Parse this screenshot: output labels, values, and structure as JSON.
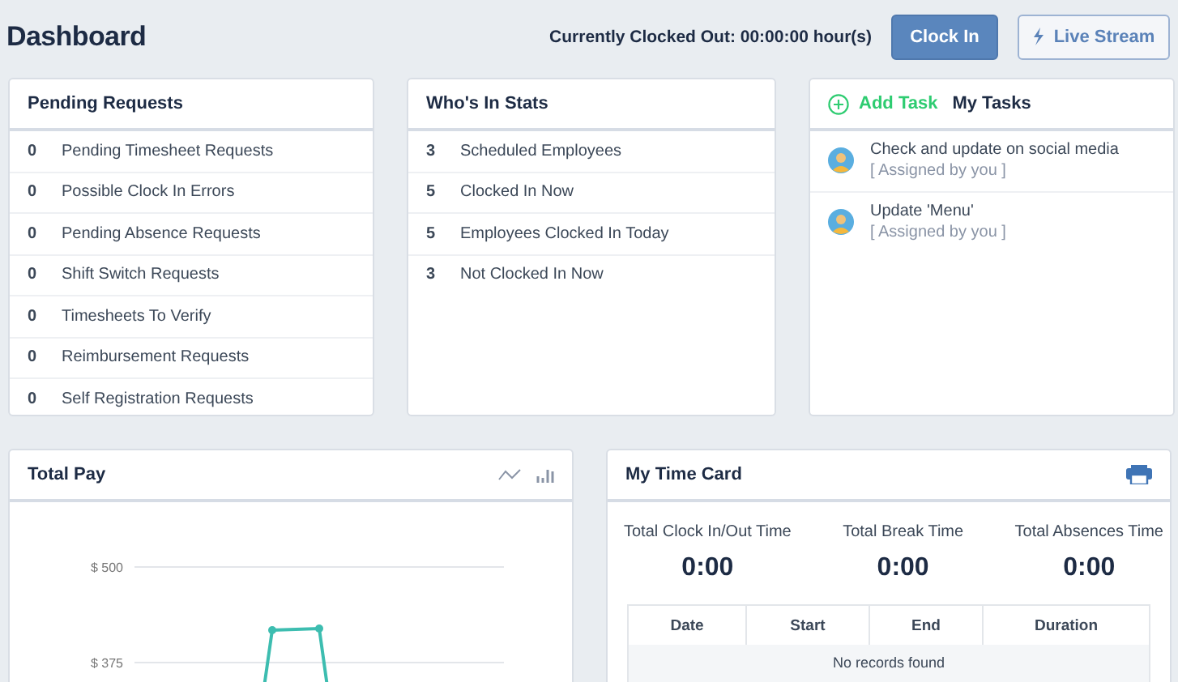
{
  "header": {
    "title": "Dashboard",
    "clock_status": "Currently Clocked Out: 00:00:00 hour(s)",
    "clock_in_button": "Clock In",
    "live_stream_button": "Live Stream"
  },
  "pending_requests": {
    "title": "Pending Requests",
    "rows": [
      {
        "count": "0",
        "label": "Pending Timesheet Requests"
      },
      {
        "count": "0",
        "label": "Possible Clock In Errors"
      },
      {
        "count": "0",
        "label": "Pending Absence Requests"
      },
      {
        "count": "0",
        "label": "Shift Switch Requests"
      },
      {
        "count": "0",
        "label": "Timesheets To Verify"
      },
      {
        "count": "0",
        "label": "Reimbursement Requests"
      },
      {
        "count": "0",
        "label": "Self Registration Requests"
      }
    ]
  },
  "whos_in_stats": {
    "title": "Who's In Stats",
    "rows": [
      {
        "count": "3",
        "label": "Scheduled Employees"
      },
      {
        "count": "5",
        "label": "Clocked In Now"
      },
      {
        "count": "5",
        "label": "Employees Clocked In Today"
      },
      {
        "count": "3",
        "label": "Not Clocked In Now"
      }
    ]
  },
  "tasks": {
    "add_task": "Add Task",
    "title": "My Tasks",
    "items": [
      {
        "title": "Check and update on social media",
        "note": "[ Assigned by you ]"
      },
      {
        "title": "Update 'Menu'",
        "note": "[ Assigned by you ]"
      }
    ]
  },
  "total_pay": {
    "title": "Total Pay",
    "y_axis_labels": [
      "$ 500",
      "$ 375"
    ]
  },
  "time_card": {
    "title": "My Time Card",
    "stats": [
      {
        "label": "Total Clock In/Out Time",
        "value": "0:00"
      },
      {
        "label": "Total Break Time",
        "value": "0:00"
      },
      {
        "label": "Total Absences Time",
        "value": "0:00"
      }
    ],
    "columns": [
      "Date",
      "Start",
      "End",
      "Duration"
    ],
    "empty_message": "No records found"
  }
}
